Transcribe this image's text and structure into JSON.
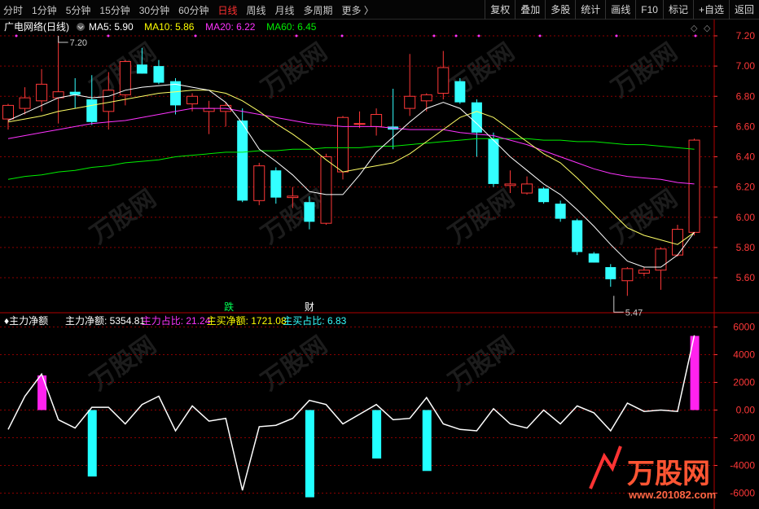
{
  "toolbar": {
    "periods": [
      "分时",
      "1分钟",
      "5分钟",
      "15分钟",
      "30分钟",
      "60分钟",
      "日线",
      "周线",
      "月线",
      "多周期",
      "更多 〉"
    ],
    "active_period": "日线",
    "actions": [
      "复权",
      "叠加",
      "多股",
      "统计",
      "画线",
      "F10",
      "标记",
      "+自选",
      "返回"
    ]
  },
  "main_panel": {
    "stock_name": "广电网络(日线)",
    "legend": [
      {
        "label": "MA5: 5.90",
        "color": "#ffffff"
      },
      {
        "label": "MA10: 5.86",
        "color": "#ffff00"
      },
      {
        "label": "MA20: 6.22",
        "color": "#ff33ff"
      },
      {
        "label": "MA60: 6.45",
        "color": "#00ee00"
      }
    ],
    "price_axis": [
      "7.20",
      "7.00",
      "6.80",
      "6.60",
      "6.40",
      "6.20",
      "6.00",
      "5.80",
      "5.60"
    ],
    "high_annotation": "7.20",
    "low_annotation": "5.47",
    "markers": [
      {
        "text": "跌",
        "color": "#00ff55"
      },
      {
        "text": "财",
        "color": "#ffffff"
      }
    ]
  },
  "indicator_panel": {
    "title": "主力净额",
    "values": [
      {
        "label": "主力净额: 5354.81",
        "color": "#ffffff"
      },
      {
        "label": "主力占比: 21.24",
        "color": "#ff33ff"
      },
      {
        "label": "主买净额: 1721.08",
        "color": "#ffff00"
      },
      {
        "label": "主买占比: 6.83",
        "color": "#33ffff"
      }
    ],
    "axis": [
      "6000",
      "4000",
      "2000",
      "0.00",
      "-2000",
      "-4000",
      "-6000"
    ]
  },
  "watermark": {
    "brand": "万股网",
    "url": "www.201082.com"
  },
  "colors": {
    "up": "#ff3838",
    "down": "#33ffff",
    "grid": "#8b0000",
    "axis_text": "#ff3838"
  },
  "chart_data": {
    "type": "candlestick",
    "price_ylim": [
      5.45,
      7.28
    ],
    "candles": [
      {
        "o": 6.65,
        "h": 6.75,
        "l": 6.58,
        "c": 6.74
      },
      {
        "o": 6.72,
        "h": 6.86,
        "l": 6.68,
        "c": 6.79
      },
      {
        "o": 6.77,
        "h": 6.98,
        "l": 6.7,
        "c": 6.88
      },
      {
        "o": 6.79,
        "h": 7.2,
        "l": 6.62,
        "c": 6.83
      },
      {
        "o": 6.83,
        "h": 6.92,
        "l": 6.72,
        "c": 6.81
      },
      {
        "o": 6.78,
        "h": 6.94,
        "l": 6.61,
        "c": 6.63
      },
      {
        "o": 6.7,
        "h": 6.96,
        "l": 6.58,
        "c": 6.84
      },
      {
        "o": 6.81,
        "h": 7.04,
        "l": 6.74,
        "c": 7.03
      },
      {
        "o": 7.01,
        "h": 7.12,
        "l": 6.95,
        "c": 6.95
      },
      {
        "o": 7.0,
        "h": 7.04,
        "l": 6.88,
        "c": 6.89
      },
      {
        "o": 6.9,
        "h": 6.92,
        "l": 6.68,
        "c": 6.74
      },
      {
        "o": 6.75,
        "h": 6.82,
        "l": 6.7,
        "c": 6.8
      },
      {
        "o": 6.7,
        "h": 6.77,
        "l": 6.55,
        "c": 6.72
      },
      {
        "o": 6.7,
        "h": 6.76,
        "l": 6.6,
        "c": 6.74
      },
      {
        "o": 6.64,
        "h": 6.72,
        "l": 6.1,
        "c": 6.11
      },
      {
        "o": 6.11,
        "h": 6.36,
        "l": 6.08,
        "c": 6.34
      },
      {
        "o": 6.31,
        "h": 6.33,
        "l": 6.09,
        "c": 6.13
      },
      {
        "o": 6.13,
        "h": 6.2,
        "l": 6.06,
        "c": 6.14
      },
      {
        "o": 6.1,
        "h": 6.14,
        "l": 5.92,
        "c": 5.97
      },
      {
        "o": 5.96,
        "h": 6.42,
        "l": 5.95,
        "c": 6.4
      },
      {
        "o": 6.3,
        "h": 6.67,
        "l": 6.25,
        "c": 6.66
      },
      {
        "o": 6.62,
        "h": 6.7,
        "l": 6.59,
        "c": 6.62
      },
      {
        "o": 6.6,
        "h": 6.72,
        "l": 6.54,
        "c": 6.68
      },
      {
        "o": 6.6,
        "h": 6.85,
        "l": 6.45,
        "c": 6.58
      },
      {
        "o": 6.72,
        "h": 7.08,
        "l": 6.67,
        "c": 6.8
      },
      {
        "o": 6.77,
        "h": 6.82,
        "l": 6.7,
        "c": 6.81
      },
      {
        "o": 6.82,
        "h": 7.1,
        "l": 6.78,
        "c": 6.99
      },
      {
        "o": 6.9,
        "h": 6.92,
        "l": 6.75,
        "c": 6.76
      },
      {
        "o": 6.76,
        "h": 6.78,
        "l": 6.4,
        "c": 6.56
      },
      {
        "o": 6.52,
        "h": 6.56,
        "l": 6.2,
        "c": 6.22
      },
      {
        "o": 6.21,
        "h": 6.31,
        "l": 6.16,
        "c": 6.22
      },
      {
        "o": 6.16,
        "h": 6.27,
        "l": 6.15,
        "c": 6.22
      },
      {
        "o": 6.19,
        "h": 6.2,
        "l": 6.09,
        "c": 6.1
      },
      {
        "o": 6.09,
        "h": 6.11,
        "l": 5.97,
        "c": 5.99
      },
      {
        "o": 5.98,
        "h": 5.99,
        "l": 5.75,
        "c": 5.77
      },
      {
        "o": 5.76,
        "h": 5.77,
        "l": 5.7,
        "c": 5.7
      },
      {
        "o": 5.67,
        "h": 5.69,
        "l": 5.54,
        "c": 5.59
      },
      {
        "o": 5.58,
        "h": 5.67,
        "l": 5.48,
        "c": 5.66
      },
      {
        "o": 5.63,
        "h": 5.67,
        "l": 5.61,
        "c": 5.65
      },
      {
        "o": 5.65,
        "h": 5.8,
        "l": 5.52,
        "c": 5.79
      },
      {
        "o": 5.75,
        "h": 5.95,
        "l": 5.74,
        "c": 5.92
      },
      {
        "o": 5.9,
        "h": 6.52,
        "l": 5.88,
        "c": 6.51
      }
    ],
    "ma5": [
      6.64,
      6.69,
      6.74,
      6.79,
      6.81,
      6.79,
      6.8,
      6.84,
      6.86,
      6.87,
      6.88,
      6.86,
      6.84,
      6.76,
      6.62,
      6.45,
      6.37,
      6.28,
      6.17,
      6.15,
      6.15,
      6.28,
      6.43,
      6.53,
      6.63,
      6.72,
      6.76,
      6.72,
      6.62,
      6.51,
      6.4,
      6.31,
      6.22,
      6.15,
      6.05,
      5.94,
      5.82,
      5.71,
      5.67,
      5.67,
      5.75,
      5.9
    ],
    "ma10": [
      6.63,
      6.65,
      6.67,
      6.7,
      6.72,
      6.74,
      6.76,
      6.78,
      6.8,
      6.82,
      6.83,
      6.84,
      6.84,
      6.82,
      6.77,
      6.7,
      6.62,
      6.55,
      6.47,
      6.38,
      6.3,
      6.32,
      6.34,
      6.36,
      6.42,
      6.5,
      6.58,
      6.66,
      6.7,
      6.66,
      6.58,
      6.5,
      6.42,
      6.36,
      6.26,
      6.15,
      6.04,
      5.93,
      5.88,
      5.85,
      5.82,
      5.9
    ],
    "ma20": [
      6.52,
      6.54,
      6.56,
      6.58,
      6.6,
      6.62,
      6.63,
      6.64,
      6.66,
      6.68,
      6.7,
      6.72,
      6.72,
      6.72,
      6.7,
      6.68,
      6.66,
      6.64,
      6.62,
      6.61,
      6.6,
      6.6,
      6.6,
      6.59,
      6.58,
      6.58,
      6.58,
      6.56,
      6.55,
      6.54,
      6.51,
      6.48,
      6.44,
      6.4,
      6.36,
      6.32,
      6.29,
      6.27,
      6.26,
      6.25,
      6.23,
      6.22
    ],
    "ma60": [
      6.25,
      6.27,
      6.28,
      6.3,
      6.31,
      6.33,
      6.34,
      6.36,
      6.37,
      6.38,
      6.4,
      6.41,
      6.42,
      6.43,
      6.43,
      6.44,
      6.44,
      6.45,
      6.45,
      6.46,
      6.46,
      6.46,
      6.47,
      6.47,
      6.48,
      6.49,
      6.5,
      6.51,
      6.52,
      6.52,
      6.52,
      6.52,
      6.51,
      6.51,
      6.5,
      6.5,
      6.49,
      6.48,
      6.48,
      6.47,
      6.46,
      6.45
    ],
    "indicator_ylim": [
      -7000,
      6800
    ],
    "indicator_line": [
      -1400,
      1000,
      2600,
      -700,
      -1300,
      200,
      200,
      -1000,
      400,
      1000,
      -1500,
      300,
      -800,
      -600,
      -5800,
      -1200,
      -1100,
      -600,
      700,
      400,
      -1000,
      -300,
      400,
      -700,
      -600,
      900,
      -1000,
      -1400,
      -1500,
      100,
      -1000,
      -1300,
      0,
      -1000,
      300,
      -200,
      -1500,
      500,
      -100,
      0,
      -100,
      5400
    ],
    "indicator_bars": [
      0,
      0,
      2500,
      0,
      0,
      -4800,
      0,
      0,
      0,
      0,
      0,
      0,
      0,
      0,
      0,
      0,
      0,
      0,
      -6300,
      0,
      0,
      0,
      -3500,
      0,
      0,
      -4400,
      0,
      0,
      0,
      0,
      0,
      0,
      0,
      0,
      0,
      0,
      0,
      0,
      0,
      0,
      0,
      5355
    ]
  }
}
